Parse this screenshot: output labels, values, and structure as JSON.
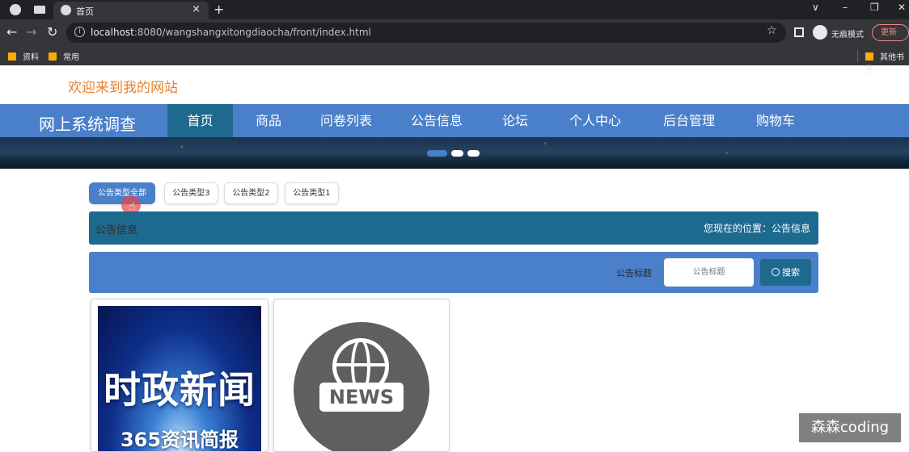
{
  "browser": {
    "tab_title": "首页",
    "tab_close": "×",
    "new_tab": "+",
    "window_controls": [
      "∨",
      "–",
      "❐",
      "✕"
    ],
    "url_host": "localhost",
    "url_rest": ":8080/wangshangxitongdiaocha/front/index.html",
    "incognito_label": "无痕模式",
    "update_label": "更新",
    "bookmarks": [
      "资料",
      "常用"
    ],
    "other_bookmarks": "其他书签"
  },
  "site": {
    "welcome": "欢迎来到我的网站",
    "brand": "网上系统调查",
    "nav": [
      "首页",
      "商品",
      "问卷列表",
      "公告信息",
      "论坛",
      "个人中心",
      "后台管理",
      "购物车"
    ],
    "active_nav_index": 0
  },
  "banner": {
    "slide_count": 3,
    "active_slide": 1
  },
  "filters": {
    "chips": [
      "公告类型全部",
      "公告类型3",
      "公告类型2",
      "公告类型1"
    ],
    "active_index": 0
  },
  "location": {
    "section": "公告信息",
    "breadcrumb": "您现在的位置：公告信息"
  },
  "search": {
    "label": "公告标题",
    "placeholder": "公告标题",
    "button": "搜索"
  },
  "cards": [
    {
      "title": "时政新闻",
      "subtitle": "365资讯简报"
    },
    {
      "badge": "NEWS"
    }
  ],
  "watermark": "森森coding",
  "colors": {
    "nav_blue": "#4a7fc9",
    "nav_active": "#1e6a8f",
    "welcome_orange": "#e8822d"
  }
}
